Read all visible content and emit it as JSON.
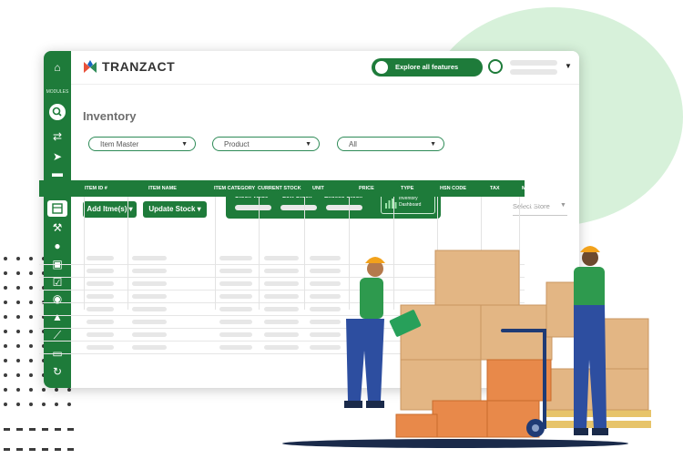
{
  "brand": {
    "name": "TRANZACT"
  },
  "header": {
    "explore_label": "Explore all features"
  },
  "sidebar": {
    "modules_label": "MODULES"
  },
  "page": {
    "title": "Inventory"
  },
  "filters": [
    {
      "label": "Item Master"
    },
    {
      "label": "Product"
    },
    {
      "label": "All"
    }
  ],
  "actions": {
    "add_items": "Add Itme(s) ▾",
    "update_stock": "Update Stock ▾"
  },
  "stock_panel": {
    "value": "Stock Value",
    "low": "Low Stock",
    "excess": "Excess Stock",
    "dashboard": "Inventory Dashboard"
  },
  "store_select": {
    "placeholder": "Select Store"
  },
  "table": {
    "columns": [
      "ITEM ID #",
      "ITEM NAME",
      "ITEM CATEGORY",
      "CURRENT STOCK",
      "UNIT",
      "PRICE",
      "TYPE",
      "HSN CODE",
      "TAX",
      "MIN STOCK LEVEL"
    ]
  },
  "colors": {
    "primary": "#1e7b3a",
    "accent_circle": "#d7f1da",
    "box": "#e3b684",
    "orange_box": "#e8894a"
  },
  "icons": [
    "home-icon",
    "search-icon",
    "flow-icon",
    "send-icon",
    "folder-icon",
    "rupee-icon",
    "inventory-icon",
    "hammer-icon",
    "bulb-icon",
    "id-card-icon",
    "checklist-icon",
    "eye-icon",
    "mountain-icon",
    "chart-icon",
    "money-icon",
    "refresh-icon"
  ]
}
